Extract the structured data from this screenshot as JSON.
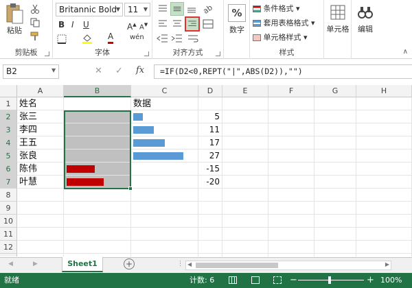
{
  "ribbon": {
    "clipboard": {
      "paste": "粘贴",
      "group": "剪贴板"
    },
    "font": {
      "name": "Britannic Bold",
      "size": "11",
      "group": "字体",
      "bold": "B",
      "italic": "I",
      "underline": "U",
      "font_color": "A",
      "phonetic": "wén"
    },
    "alignment": {
      "group": "对齐方式"
    },
    "number": {
      "percent": "%",
      "label": "数字"
    },
    "styles": {
      "conditional": "条件格式",
      "table": "套用表格格式",
      "cell_styles": "单元格样式",
      "group": "样式"
    },
    "cells": {
      "label": "单元格"
    },
    "editing": {
      "label": "编辑"
    }
  },
  "formula_bar": {
    "name_box": "B2",
    "cancel": "✕",
    "enter": "✓",
    "fx": "fx",
    "formula": "=IF(D2<0,REPT(\"|\",ABS(D2)),\"\")"
  },
  "columns": [
    "A",
    "B",
    "C",
    "D",
    "E",
    "F",
    "G",
    "H"
  ],
  "rows": [
    "1",
    "2",
    "3",
    "4",
    "5",
    "6",
    "7",
    "8",
    "9",
    "10",
    "11",
    "12",
    "13"
  ],
  "cells": {
    "header_name": "姓名",
    "header_data": "数据",
    "names": [
      "张三",
      "李四",
      "王五",
      "张良",
      "陈伟",
      "叶慧"
    ],
    "values": [
      "5",
      "11",
      "17",
      "27",
      "-15",
      "-20"
    ]
  },
  "bars": {
    "positive": [
      5,
      11,
      17,
      27,
      0,
      0
    ],
    "negative": [
      0,
      0,
      0,
      0,
      15,
      20
    ],
    "pos_color": "#5b9bd5",
    "neg_color": "#c00000"
  },
  "sheet_tab": "Sheet1",
  "add_sheet": "+",
  "status": {
    "ready": "就绪",
    "count": "计数: 6",
    "zoom": "100%",
    "zoom_minus": "−",
    "zoom_plus": "+"
  },
  "colors": {
    "accent": "#217346",
    "selection_fill": "#c0c0c0",
    "highlight_box": "#e03030"
  }
}
